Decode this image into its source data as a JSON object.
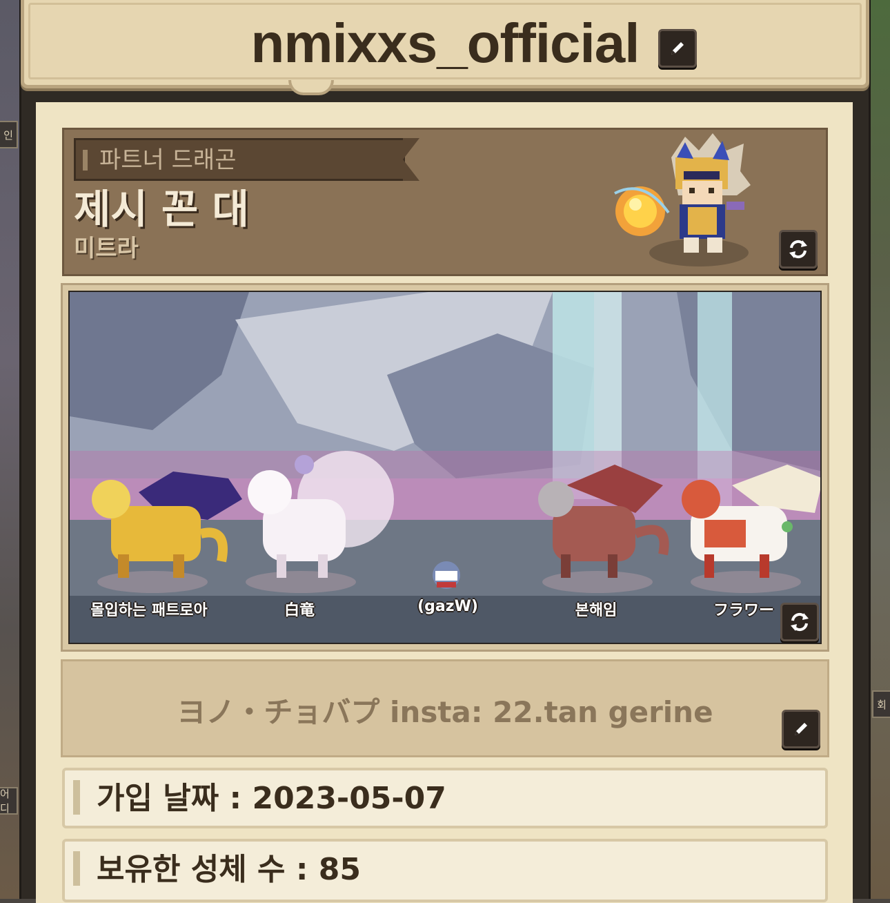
{
  "profile": {
    "username": "nmixxs_official",
    "partner_section_label": "파트너 드래곤",
    "partner_dragon_name": "제시 꼰 대",
    "partner_dragon_species": "미트라",
    "bio": "ヨノ・チョバプ insta: 22.tan gerine",
    "join_date": "가입 날짜 : 2023-05-07",
    "owned_stars": "보유한 성체 수 : 85"
  },
  "team": {
    "dragons": [
      {
        "label": "몰입하는 패트로아",
        "color": "#e7b93a"
      },
      {
        "label": "白竜",
        "color": "#f3e9f3"
      },
      {
        "label": "(gazW)",
        "color": "#7a8bb5"
      },
      {
        "label": "본해임",
        "color": "#a45a52"
      },
      {
        "label": "フラワー",
        "color": "#d85a3c"
      }
    ]
  },
  "icons": {
    "edit_name": "pencil-icon",
    "swap_partner": "swap-icon",
    "swap_team": "swap-icon",
    "edit_bio": "pencil-icon"
  },
  "side_tabs": {
    "left_top": "인",
    "left_bottom": "어디",
    "right": "회"
  }
}
